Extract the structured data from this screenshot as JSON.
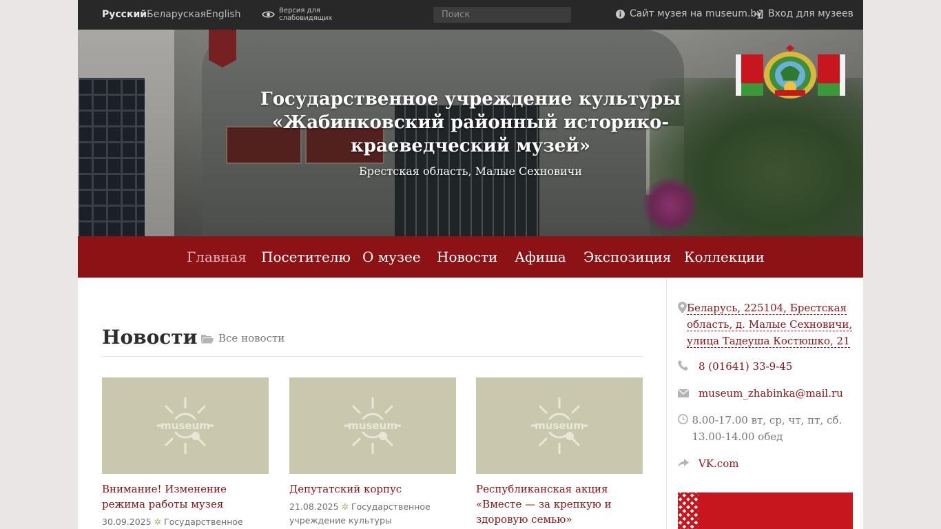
{
  "topbar": {
    "languages": [
      {
        "label": "Русский",
        "active": true
      },
      {
        "label": "Беларуская",
        "active": false
      },
      {
        "label": "English",
        "active": false
      }
    ],
    "vision_version": "Версия для слабовидящих",
    "search_placeholder": "Поиск",
    "museum_site_link": "Сайт музея на museum.by",
    "login_link": "Вход для музеев"
  },
  "hero": {
    "title": "Государственное учреждение культуры «Жабинковский районный историко-краеведческий музей»",
    "subtitle": "Брестская область, Малые Сехновичи"
  },
  "nav": {
    "items": [
      {
        "label": "Главная",
        "active": true
      },
      {
        "label": "Посетителю",
        "active": false
      },
      {
        "label": "О музее",
        "active": false
      },
      {
        "label": "Новости",
        "active": false
      },
      {
        "label": "Афиша",
        "active": false
      },
      {
        "label": "Экспозиция",
        "active": false
      },
      {
        "label": "Коллекции",
        "active": false
      }
    ]
  },
  "news": {
    "heading": "Новости",
    "all_news_link": "Все новости",
    "items": [
      {
        "title": "Внимание! Изменение режима работы музея",
        "date": "30.09.2025",
        "source": "Государственное"
      },
      {
        "title": "Депутатский корпус",
        "date": "21.08.2025",
        "source": "Государственное учреждение культуры «Жабинковский"
      },
      {
        "title": "Республиканская акция «Вместе — за крепкую и здоровую семью»",
        "date": "",
        "source": ""
      }
    ]
  },
  "sidebar": {
    "address": "Беларусь, 225104, Брестская область, д. Малые Сехновичи, улица Тадеуша Костюшко, 21",
    "phone": "8 (01641) 33-9-45",
    "email": "museum_zhabinka@mail.ru",
    "hours": "8.00-17.00 вт, ср, чт, пт, сб. 13.00-14.00 обед",
    "social": "VK.com"
  },
  "colors": {
    "accent": "#8d1216",
    "topbar": "#282828",
    "thumb_placeholder": "#c9c8ad"
  }
}
